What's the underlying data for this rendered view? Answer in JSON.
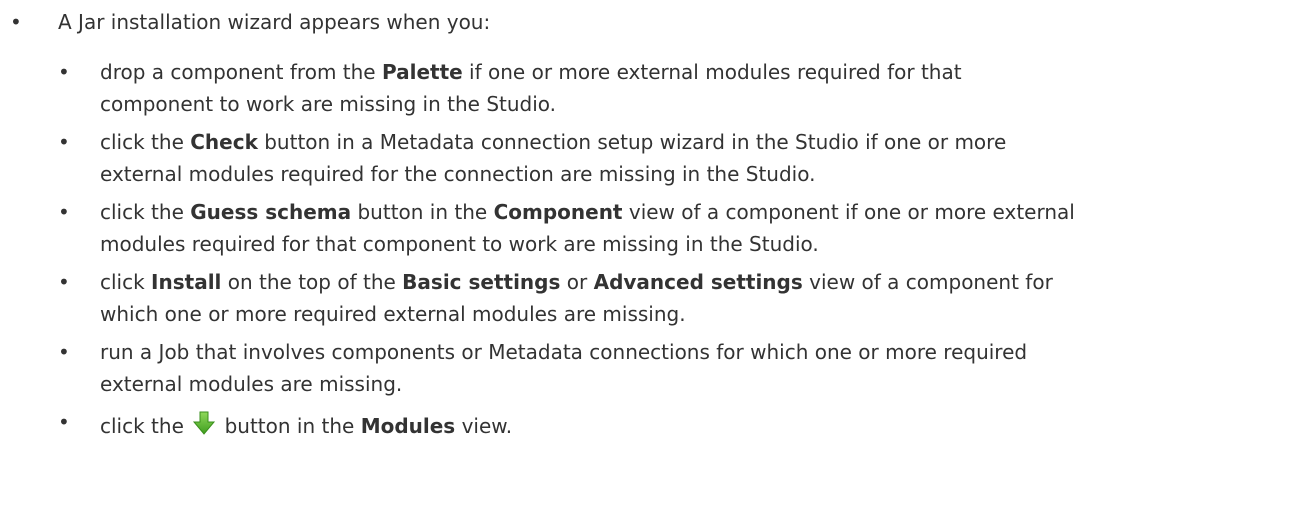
{
  "intro": {
    "text": "A Jar installation wizard appears when you:"
  },
  "items": [
    {
      "t1": "drop a component from the ",
      "b1": "Palette",
      "t2": " if one or more external modules required for that",
      "t3": "component to work are missing in the Studio."
    },
    {
      "t1": "click the ",
      "b1": "Check",
      "t2": " button in a Metadata connection setup wizard in the Studio if one or more",
      "t3": "external modules required for the connection are missing in the Studio."
    },
    {
      "t1": "click the ",
      "b1": "Guess schema",
      "t2": " button in the ",
      "b2": "Component",
      "t3": " view of a component if one or more external",
      "t4": "modules required for that component to work are missing in the Studio."
    },
    {
      "t1": "click ",
      "b1": "Install",
      "t2": " on the top of the ",
      "b2": "Basic settings",
      "t3": " or ",
      "b3": "Advanced settings",
      "t4": " view of a component for",
      "t5": "which one or more required external modules are missing."
    },
    {
      "t1": "run a Job that involves components or Metadata connections for which one or more required",
      "t2": "external modules are missing."
    },
    {
      "t1": "click the ",
      "icon": "green-down-arrow-icon",
      "t2": " button in the ",
      "b1": "Modules",
      "t3": " view."
    }
  ],
  "bullet": "•",
  "colors": {
    "text": "#333333",
    "arrow_green": "#5cb82e"
  }
}
